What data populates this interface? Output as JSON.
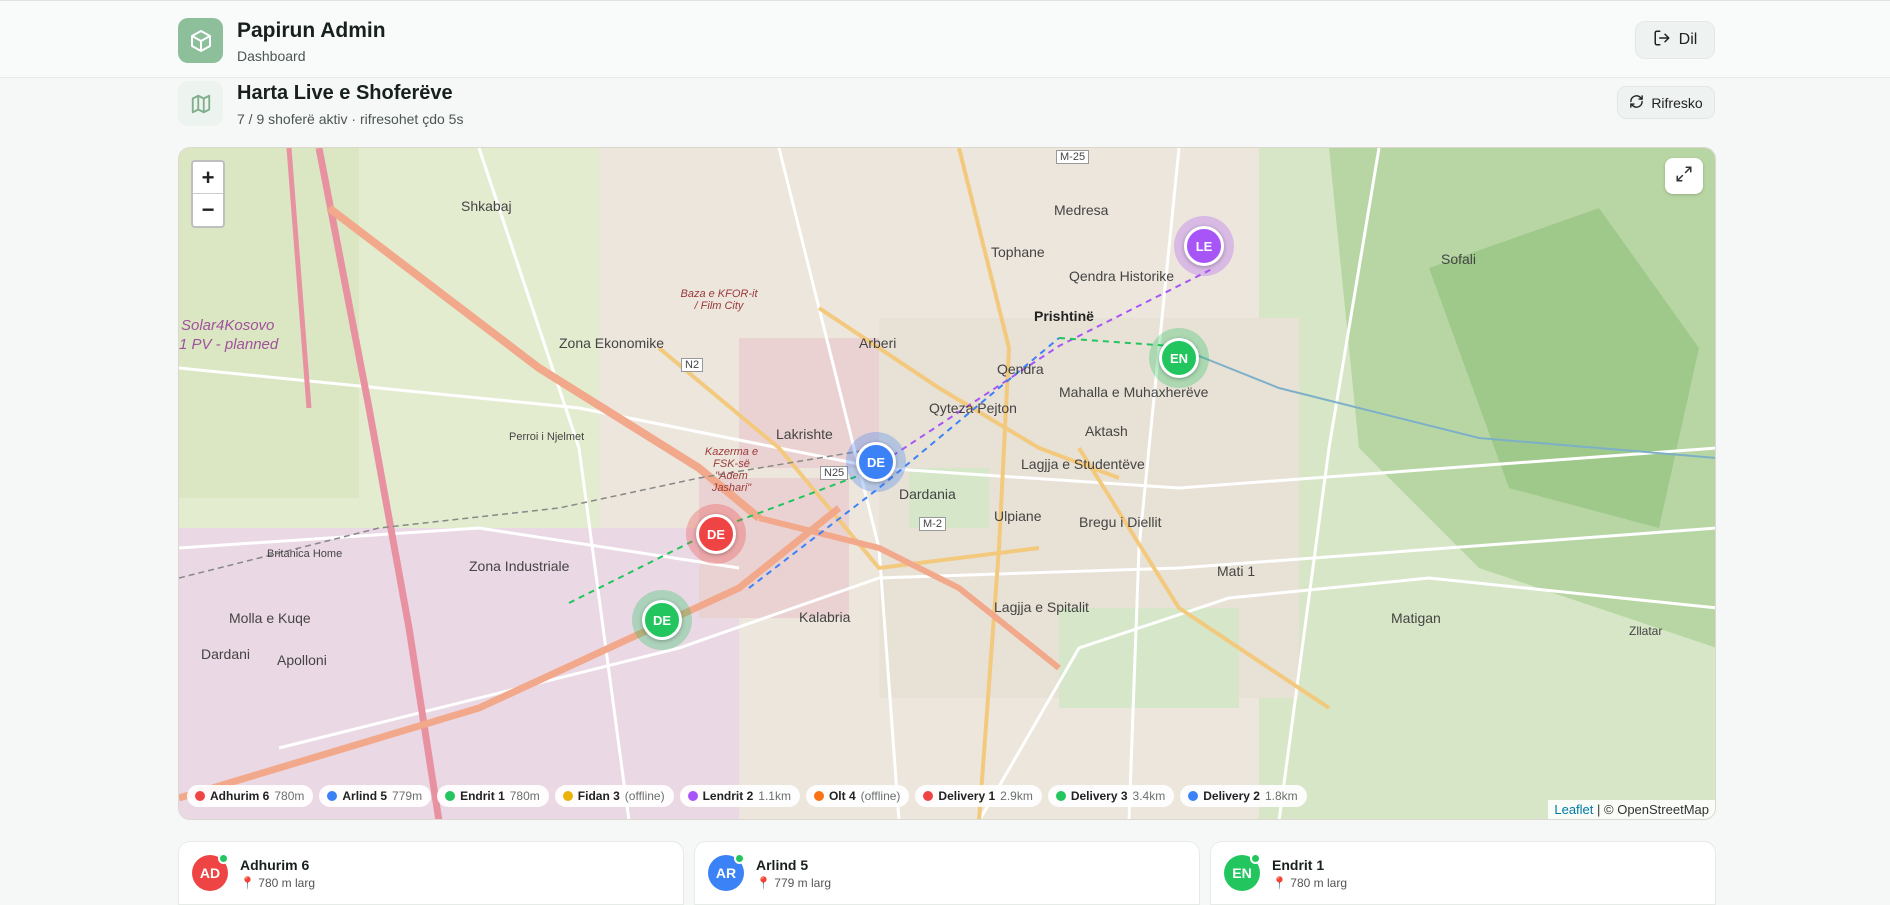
{
  "app": {
    "title": "Papirun Admin",
    "subtitle": "Dashboard",
    "logout_label": "Dil",
    "brand_color": "#8dbf9b"
  },
  "section": {
    "title": "Harta Live e Shoferëve",
    "subtitle": "7 / 9 shoferë aktiv · rifresohet çdo 5s",
    "refresh_label": "Rifresko"
  },
  "map": {
    "zoom_in": "+",
    "zoom_out": "−",
    "attribution_leaflet": "Leaflet",
    "attribution_rest": "| © OpenStreetMap",
    "labels": [
      "Prishtinë",
      "Zona Ekonomike",
      "Zona Industriale",
      "Arberi",
      "Qendra",
      "Qendra Historike",
      "Tophane",
      "Medresa",
      "Mahalla e Muhaxherëve",
      "Aktash",
      "Lagjja e Studentëve",
      "Ulpiane",
      "Bregu i Diellit",
      "Dardania",
      "Kalabria",
      "Lagjja e Spitalit",
      "Mati 1",
      "Matigan",
      "Sofali",
      "Molla e Kuqe",
      "Dardani",
      "Apolloni",
      "Britanica Home",
      "Shkabaj",
      "Perroi i Njelmet",
      "Lakrishte",
      "Qyteza Pejton",
      "Zllatar",
      "Solar4Kosovo",
      "1 PV - planned",
      "Baza e KFOR-it / Film City",
      "Kazerma e FSK-së \"Adem Jashari\"",
      "M-25",
      "M-2",
      "N2",
      "N25"
    ],
    "markers": [
      {
        "initials": "LE",
        "color": "#a855f7"
      },
      {
        "initials": "EN",
        "color": "#22c55e"
      },
      {
        "initials": "DE",
        "color": "#3b82f6"
      },
      {
        "initials": "DE",
        "color": "#ef4444"
      },
      {
        "initials": "DE",
        "color": "#22c55e"
      }
    ],
    "legend": [
      {
        "name": "Adhurim 6",
        "dist": "780m",
        "color": "#ef4444"
      },
      {
        "name": "Arlind 5",
        "dist": "779m",
        "color": "#3b82f6"
      },
      {
        "name": "Endrit 1",
        "dist": "780m",
        "color": "#22c55e"
      },
      {
        "name": "Fidan 3",
        "dist": "(offline)",
        "color": "#eab308"
      },
      {
        "name": "Lendrit 2",
        "dist": "1.1km",
        "color": "#a855f7"
      },
      {
        "name": "Olt 4",
        "dist": "(offline)",
        "color": "#f97316"
      },
      {
        "name": "Delivery 1",
        "dist": "2.9km",
        "color": "#ef4444"
      },
      {
        "name": "Delivery 3",
        "dist": "3.4km",
        "color": "#22c55e"
      },
      {
        "name": "Delivery 2",
        "dist": "1.8km",
        "color": "#3b82f6"
      }
    ]
  },
  "drivers": [
    {
      "initials": "AD",
      "name": "Adhurim 6",
      "distance": "780 m larg",
      "color": "#ef4444"
    },
    {
      "initials": "AR",
      "name": "Arlind 5",
      "distance": "779 m larg",
      "color": "#3b82f6"
    },
    {
      "initials": "EN",
      "name": "Endrit 1",
      "distance": "780 m larg",
      "color": "#22c55e"
    }
  ]
}
